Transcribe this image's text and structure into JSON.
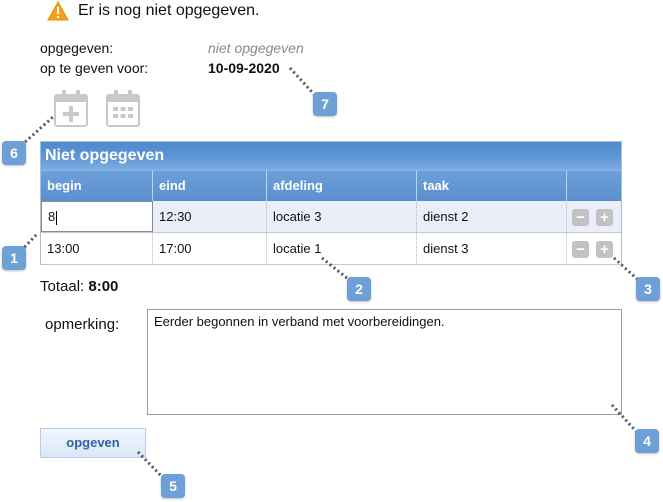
{
  "warning": {
    "icon": "warning-triangle-icon",
    "text": "Er is nog niet opgegeven."
  },
  "info": {
    "opgegeven_label": "opgegeven:",
    "opgegeven_value": "niet opgegeven",
    "deadline_label": "op te geven voor:",
    "deadline_value": "10-09-2020"
  },
  "toolbar": {
    "icons": [
      "calendar-add-icon",
      "calendar-grid-icon"
    ]
  },
  "panel": {
    "title": "Niet opgegeven",
    "columns": [
      "begin",
      "eind",
      "afdeling",
      "taak",
      ""
    ],
    "rows": [
      {
        "begin": "8",
        "eind": "12:30",
        "afdeling": "locatie 3",
        "taak": "dienst 2"
      },
      {
        "begin": "13:00",
        "eind": "17:00",
        "afdeling": "locatie 1",
        "taak": "dienst 3"
      }
    ],
    "row_actions": {
      "remove": "−",
      "add": "+"
    }
  },
  "totaal": {
    "label": "Totaal:",
    "value": "8:00"
  },
  "opmerking": {
    "label": "opmerking:",
    "value": "Eerder begonnen in verband met voorbereidingen."
  },
  "submit_label": "opgeven",
  "callouts": [
    "1",
    "2",
    "3",
    "4",
    "5",
    "6",
    "7"
  ],
  "colors": {
    "accent": "#6e9fd6",
    "header": "#5a8fcf",
    "warning": "#f2a31b"
  }
}
